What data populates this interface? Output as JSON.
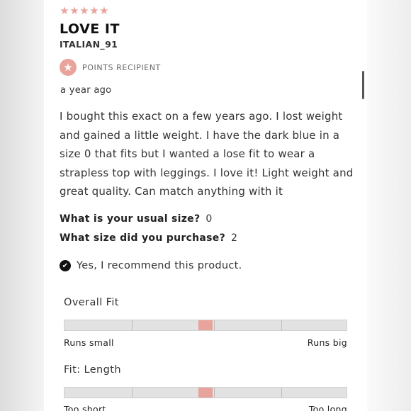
{
  "review": {
    "rating": 5,
    "title": "LOVE IT",
    "username": "ITALIAN_91",
    "badge": "POINTS RECIPIENT",
    "time": "a year ago",
    "body": "I bought this exact on a few years ago. I lost weight and gained a little weight. I have the dark blue in a size 0 that fits but I wanted a lose fit to wear a strapless top with leggings. I love it! Light weight and great quality. Can match anything with it"
  },
  "questions": [
    {
      "question": "What is your usual size?",
      "answer": "0"
    },
    {
      "question": "What size did you purchase?",
      "answer": "2"
    }
  ],
  "recommend": {
    "text": "Yes, I recommend this product."
  },
  "fit": [
    {
      "label": "Overall Fit",
      "min_label": "Runs small",
      "max_label": "Runs big",
      "value": 0.5
    },
    {
      "label": "Fit: Length",
      "min_label": "Too short",
      "max_label": "Too long",
      "value": 0.5
    }
  ],
  "icons": {
    "star": "star-icon",
    "badge": "star-badge-icon",
    "check": "check-circle-icon"
  },
  "colors": {
    "accent": "#e8a49c",
    "bar": "#e2e2e2",
    "text": "#222222"
  }
}
